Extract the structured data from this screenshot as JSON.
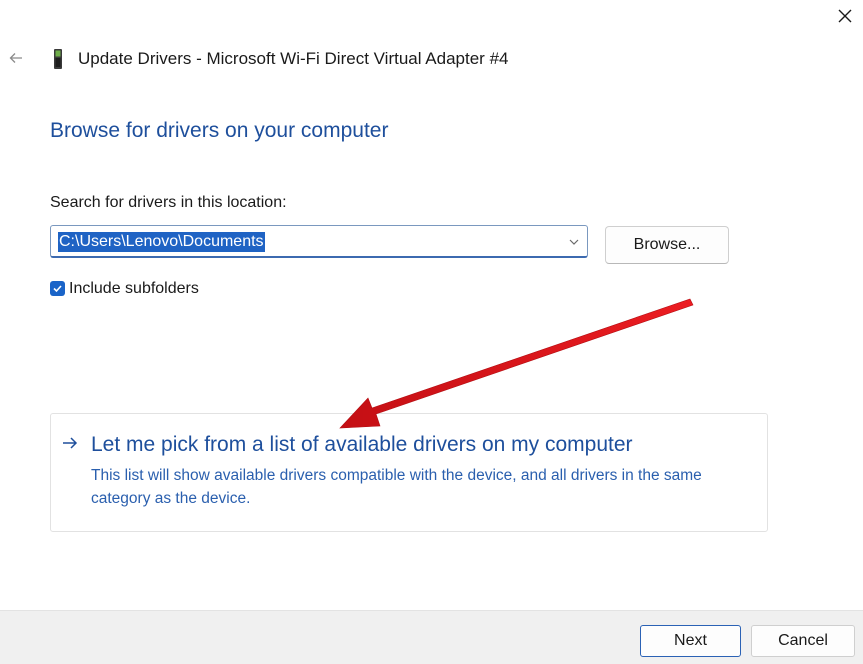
{
  "window": {
    "title": "Update Drivers - Microsoft Wi-Fi Direct Virtual Adapter #4",
    "close_icon": "close-icon",
    "back_icon": "back-arrow-icon",
    "device_icon": "device-icon"
  },
  "main": {
    "heading": "Browse for drivers on your computer",
    "search_label": "Search for drivers in this location:",
    "path_value": "C:\\Users\\Lenovo\\Documents",
    "browse_label": "Browse...",
    "include_subfolders_label": "Include subfolders",
    "include_subfolders_checked": true
  },
  "pick_option": {
    "title": "Let me pick from a list of available drivers on my computer",
    "description": "This list will show available drivers compatible with the device, and all drivers in the same category as the device.",
    "icon": "right-arrow-icon"
  },
  "footer": {
    "next_label": "Next",
    "cancel_label": "Cancel"
  },
  "colors": {
    "accent": "#1e4f9c",
    "link_text": "#2a5fae",
    "selection": "#1f63c4",
    "annotation_arrow": "#e0151b"
  }
}
